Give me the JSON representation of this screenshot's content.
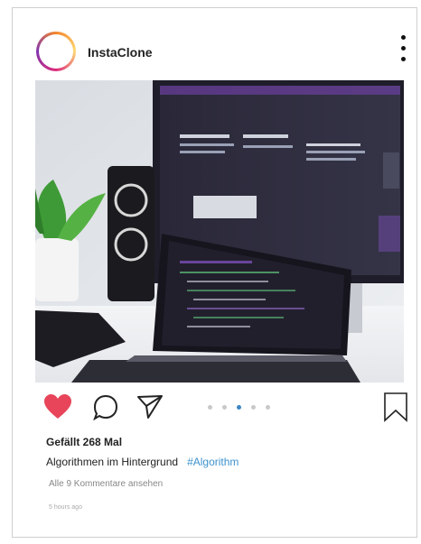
{
  "post": {
    "username": "InstaClone",
    "likes_text": "Gefällt 268 Mal",
    "caption": "Algorithmen im Hintergrund",
    "hashtag": "#Algorithm",
    "view_comments": "Alle 9 Kommentare ansehen",
    "timestamp": "5 hours ago"
  },
  "carousel": {
    "count": 5,
    "active_index": 3
  },
  "icons": {
    "heart": "heart-icon",
    "comment": "comment-icon",
    "share": "send-icon",
    "bookmark": "bookmark-icon",
    "more": "more-vertical-icon"
  },
  "colors": {
    "heart": "#e8455a",
    "hashtag": "#3d92cf",
    "active_dot": "#3b86c6"
  }
}
